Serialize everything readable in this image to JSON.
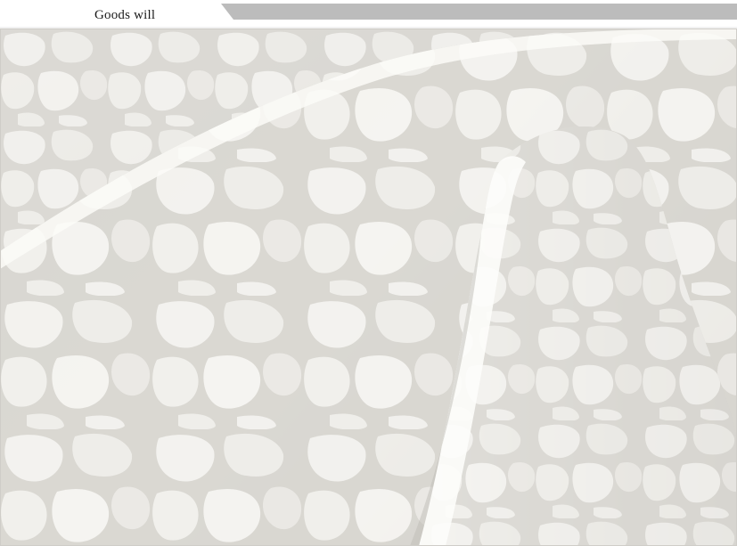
{
  "header": {
    "label": "Goods will",
    "tab_color": "#ffffff",
    "bar_color": "#bcbcbc"
  },
  "photo": {
    "subject": "wallpaper-roll",
    "pattern_color": "#f3f2ef",
    "grout_color": "#d9d7d2"
  }
}
